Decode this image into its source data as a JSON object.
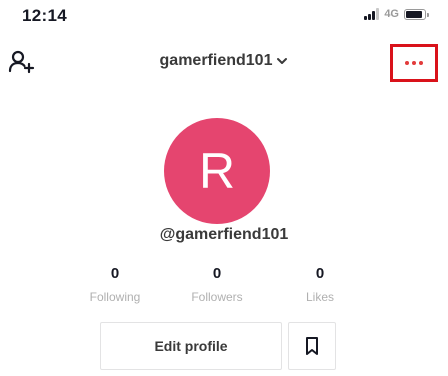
{
  "status_bar": {
    "time": "12:14",
    "network": "4G",
    "signal_icon": "signal-bars-icon",
    "battery_icon": "battery-icon"
  },
  "nav": {
    "add_user_icon": "add-user-icon",
    "username": "gamerfiend101",
    "dropdown_icon": "chevron-down-icon",
    "more_icon": "more-dots-icon",
    "highlight_color": "#d9121a"
  },
  "profile": {
    "avatar_initial": "R",
    "avatar_color": "#e5456f",
    "handle": "@gamerfiend101"
  },
  "stats": [
    {
      "count": "0",
      "label": "Following"
    },
    {
      "count": "0",
      "label": "Followers"
    },
    {
      "count": "0",
      "label": "Likes"
    }
  ],
  "actions": {
    "edit_profile_label": "Edit profile",
    "bookmark_icon": "bookmark-icon"
  }
}
